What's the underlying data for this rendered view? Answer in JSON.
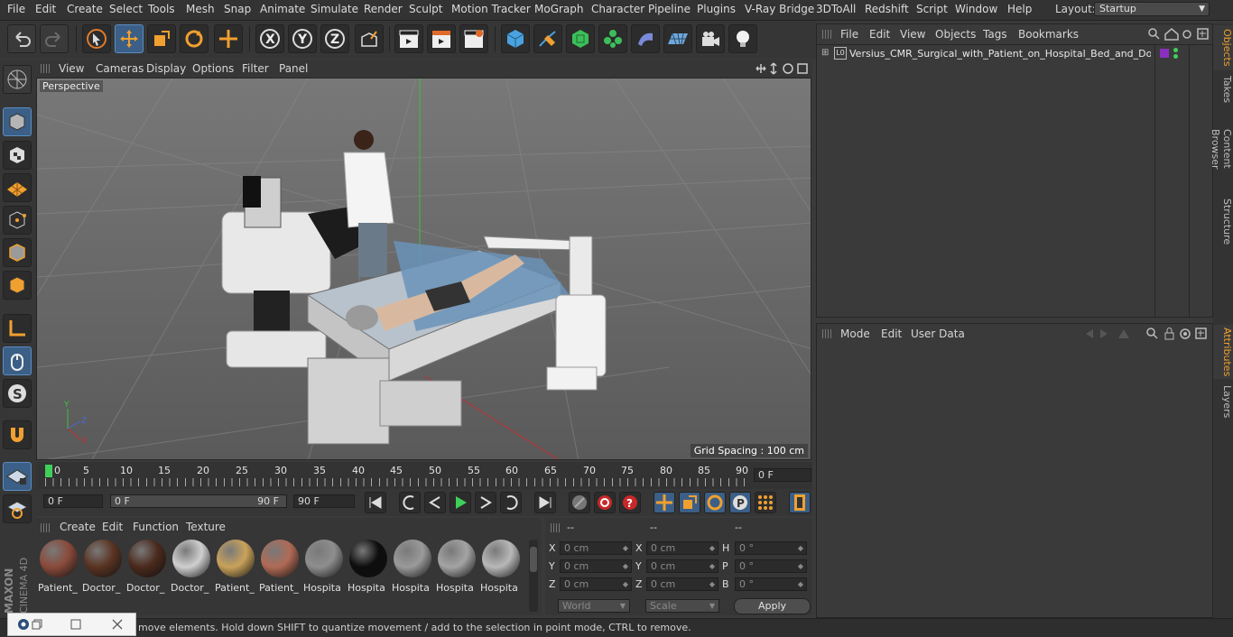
{
  "menubar": {
    "items": [
      "File",
      "Edit",
      "Create",
      "Select",
      "Tools",
      "Mesh",
      "Snap",
      "Animate",
      "Simulate",
      "Render",
      "Sculpt",
      "Motion Tracker",
      "MoGraph",
      "Character",
      "Pipeline",
      "Plugins",
      "V-Ray Bridge",
      "3DToAll",
      "Redshift",
      "Script",
      "Window",
      "Help"
    ],
    "layout_label": "Layout:",
    "layout_value": "Startup"
  },
  "viewport": {
    "menu": [
      "View",
      "Cameras",
      "Display",
      "Options",
      "Filter",
      "Panel"
    ],
    "camera_label": "Perspective",
    "grid_spacing": "Grid Spacing : 100 cm"
  },
  "timeline": {
    "ticks": [
      "0",
      "5",
      "10",
      "15",
      "20",
      "25",
      "30",
      "35",
      "40",
      "45",
      "50",
      "55",
      "60",
      "65",
      "70",
      "75",
      "80",
      "85",
      "90"
    ],
    "current_frame": "0 F",
    "start_field": "0 F",
    "range_start": "0 F",
    "range_end": "90 F",
    "end_field": "90 F"
  },
  "materials": {
    "menu": [
      "Create",
      "Edit",
      "Function",
      "Texture"
    ],
    "items": [
      {
        "label": "Patient_",
        "color": "#8a4a3a"
      },
      {
        "label": "Doctor_",
        "color": "#5a3322"
      },
      {
        "label": "Doctor_",
        "color": "#4a2a1c"
      },
      {
        "label": "Doctor_",
        "color": "#cfcfcf"
      },
      {
        "label": "Patient_",
        "color": "#c9a25a"
      },
      {
        "label": "Patient_",
        "color": "#b06a55"
      },
      {
        "label": "Hospita",
        "color": "#8e8e8e"
      },
      {
        "label": "Hospita",
        "color": "#0d0d0d"
      },
      {
        "label": "Hospita",
        "color": "#9a9a9a"
      },
      {
        "label": "Hospita",
        "color": "#a4a4a4"
      },
      {
        "label": "Hospita",
        "color": "#b8b8b8"
      }
    ]
  },
  "coordinates": {
    "headers": [
      "--",
      "--",
      "--"
    ],
    "rows": [
      {
        "a": "X",
        "av": "0 cm",
        "b": "X",
        "bv": "0 cm",
        "c": "H",
        "cv": "0 °"
      },
      {
        "a": "Y",
        "av": "0 cm",
        "b": "Y",
        "bv": "0 cm",
        "c": "P",
        "cv": "0 °"
      },
      {
        "a": "Z",
        "av": "0 cm",
        "b": "Z",
        "bv": "0 cm",
        "c": "B",
        "cv": "0 °"
      }
    ],
    "mode_select": "World",
    "scale_select": "Scale",
    "apply_label": "Apply"
  },
  "objects": {
    "menu": [
      "File",
      "Edit",
      "View",
      "Objects",
      "Tags",
      "Bookmarks"
    ],
    "tree": [
      {
        "name": "Versius_CMR_Surgical_with_Patient_on_Hospital_Bed_and_Docto",
        "layer_color": "#8a2fbf"
      }
    ]
  },
  "attributes": {
    "menu": [
      "Mode",
      "Edit",
      "User Data"
    ]
  },
  "side_tabs": [
    "Objects",
    "Takes",
    "Content Browser",
    "Structure",
    "Attributes",
    "Layers"
  ],
  "status": {
    "text": "move elements. Hold down SHIFT to quantize movement / add to the selection in point mode, CTRL to remove."
  },
  "branding": {
    "line1": "MAXON",
    "line2": "CINEMA 4D"
  },
  "accent_color": "#4a90d9"
}
